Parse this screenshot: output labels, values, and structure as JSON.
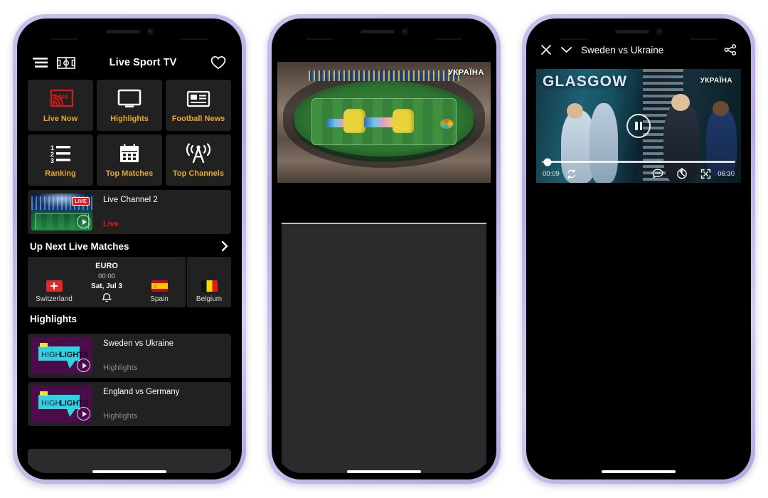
{
  "app": {
    "header": {
      "title": "Live Sport TV",
      "menu_icon": "hamburger-menu-icon",
      "pitch_icon": "soccer-pitch-icon",
      "favorite_icon": "heart-icon"
    },
    "grid_tiles": [
      {
        "label": "Live Now",
        "icon": "live-cast-icon"
      },
      {
        "label": "Highlights",
        "icon": "tv-monitor-icon"
      },
      {
        "label": "Football News",
        "icon": "news-article-icon"
      },
      {
        "label": "Ranking",
        "icon": "numbered-list-icon"
      },
      {
        "label": "Top Matches",
        "icon": "calendar-icon"
      },
      {
        "label": "Top Channels",
        "icon": "broadcast-antenna-icon"
      }
    ],
    "live_channel": {
      "title": "Live Channel 2",
      "status": "Live",
      "badge": "LIVE",
      "play_icon": "play-circle-icon"
    },
    "up_next": {
      "heading": "Up Next Live Matches",
      "chevron": "chevron-right-icon",
      "matches": [
        {
          "competition": "EURO",
          "time": "00:00",
          "date": "Sat, Jul 3",
          "home_team": "Switzerland",
          "away_team": "Spain",
          "bell_icon": "notification-bell-icon"
        },
        {
          "home_team": "Belgium"
        }
      ]
    },
    "highlights": {
      "heading": "Highlights",
      "items": [
        {
          "title": "Sweden vs Ukraine",
          "subtitle": "Highlights",
          "thumb_text_a": "HIGH",
          "thumb_text_b": "LIGHTS"
        },
        {
          "title": "England vs Germany",
          "subtitle": "Highlights",
          "thumb_text_a": "HIGH",
          "thumb_text_b": "LIGHTS"
        }
      ]
    }
  },
  "stadium_screen": {
    "watermark": "УКРАЇНА"
  },
  "player": {
    "close_icon": "close-x-icon",
    "collapse_icon": "chevron-down-icon",
    "title": "Sweden vs Ukraine",
    "share_icon": "share-icon",
    "overlay_city": "GLASGOW",
    "watermark": "УКРАЇНА",
    "pause_icon": "pause-icon",
    "current_time": "00:09",
    "duration": "06:30",
    "loop_icon": "loop-repeat-icon",
    "subtitles_icon": "subtitles-bubble-icon",
    "speed_icon": "playback-speed-icon",
    "fullscreen_icon": "fullscreen-icon",
    "progress_percent": 3
  },
  "colors": {
    "accent_gold": "#e9a82c",
    "live_red": "#e01b1b",
    "tile_bg": "#212121",
    "frame": "#c3b5e8"
  }
}
